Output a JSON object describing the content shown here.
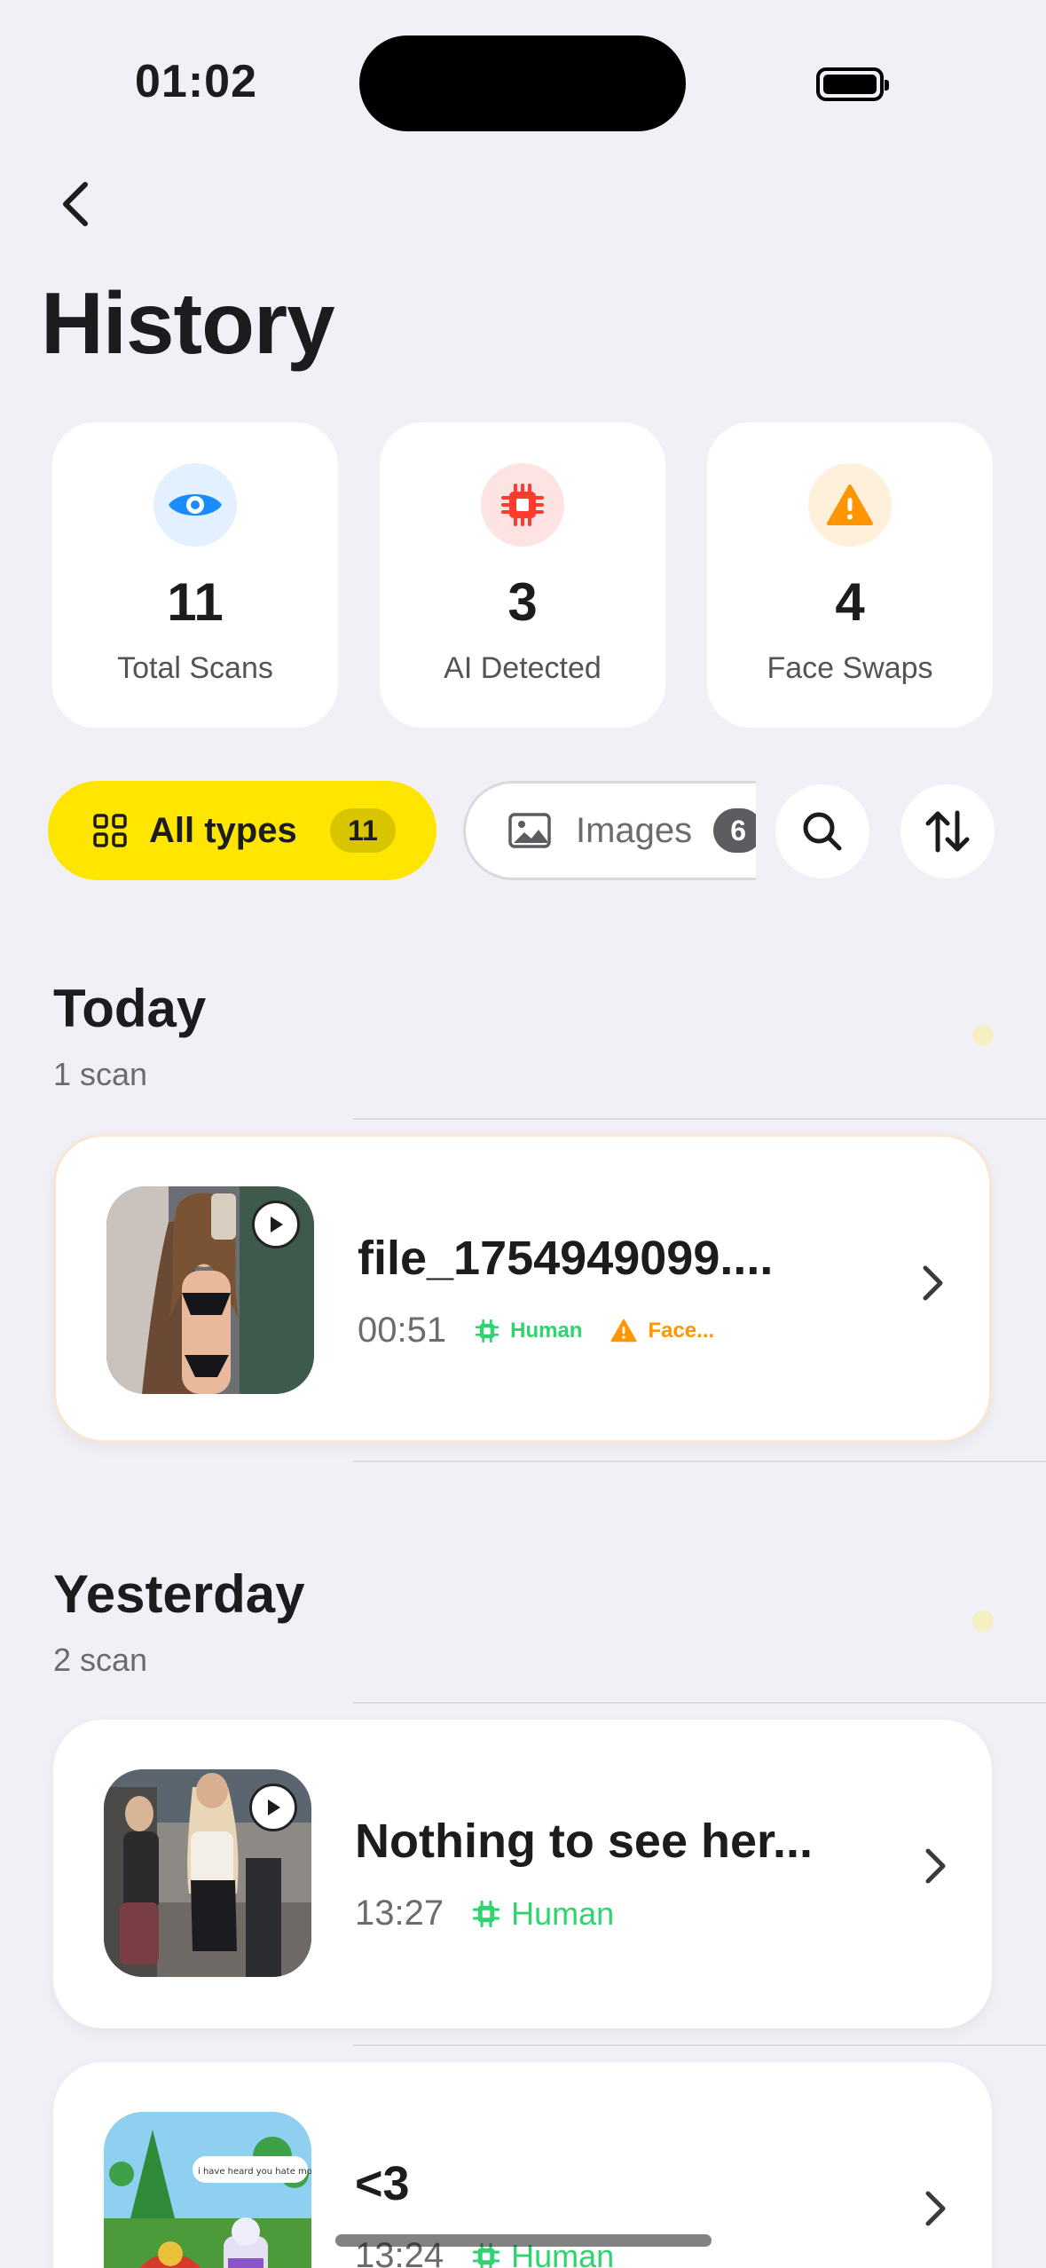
{
  "status_bar": {
    "time": "01:02"
  },
  "header": {
    "title": "History"
  },
  "stats": [
    {
      "value": "11",
      "label": "Total Scans",
      "icon": "eye-icon",
      "color": "#1a8cff",
      "bg": "#e2f0ff"
    },
    {
      "value": "3",
      "label": "AI Detected",
      "icon": "cpu-chip-icon",
      "color": "#ff3b30",
      "bg": "#fde4e2"
    },
    {
      "value": "4",
      "label": "Face Swaps",
      "icon": "warning-icon",
      "color": "#ff9500",
      "bg": "#fff0dc"
    }
  ],
  "filters": {
    "all": {
      "label": "All types",
      "count": "11",
      "icon": "grid-icon"
    },
    "images": {
      "label": "Images",
      "count": "6",
      "icon": "image-icon"
    },
    "search_icon": "search-icon",
    "sort_icon": "sort-arrows-icon"
  },
  "sections": [
    {
      "title": "Today",
      "subtitle": "1 scan",
      "items": [
        {
          "name": "file_1754949099....",
          "time": "00:51",
          "tags": [
            {
              "label": "Human",
              "kind": "human"
            },
            {
              "label": "Face...",
              "kind": "face"
            }
          ]
        }
      ]
    },
    {
      "title": "Yesterday",
      "subtitle": "2 scan",
      "items": [
        {
          "name": "Nothing to see her...",
          "time": "13:27",
          "tags": [
            {
              "label": "Human",
              "kind": "human"
            }
          ]
        },
        {
          "name": "<3",
          "time": "13:24",
          "tags": [
            {
              "label": "Human",
              "kind": "human"
            }
          ],
          "thumb_caption": "i have heard you hate monke"
        }
      ]
    }
  ]
}
